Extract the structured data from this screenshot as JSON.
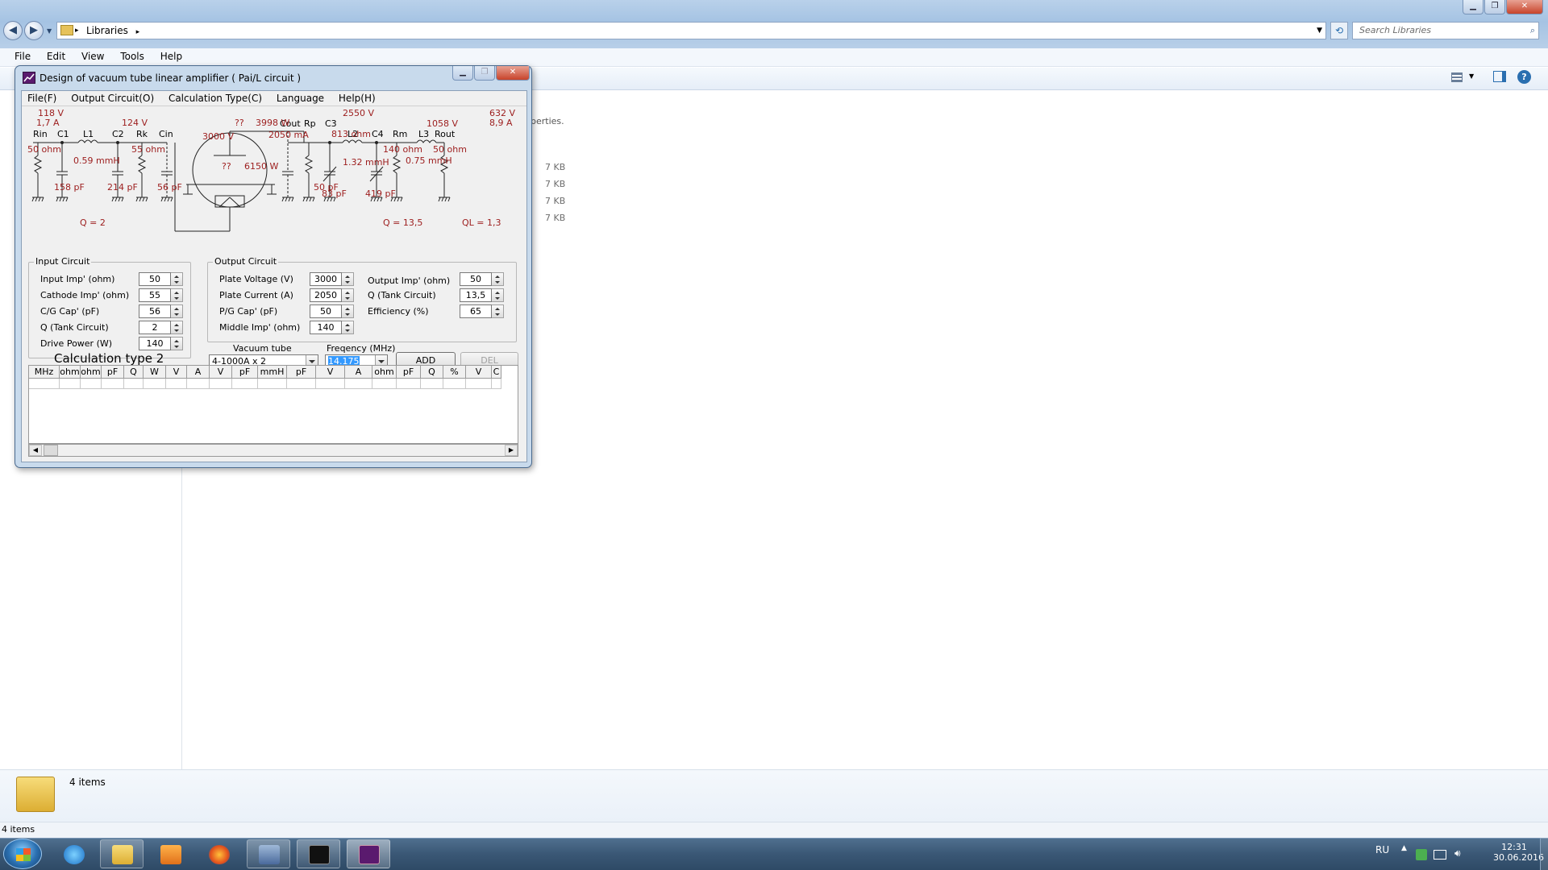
{
  "explorer": {
    "address_path": "Libraries",
    "search_placeholder": "Search Libraries",
    "menu": [
      "File",
      "Edit",
      "View",
      "Tools",
      "Help"
    ],
    "properties_fragment": "perties.",
    "file_sizes": [
      "7 KB",
      "7 KB",
      "7 KB",
      "7 KB"
    ],
    "details_count": "4 items",
    "status_count": "4 items"
  },
  "app": {
    "title": "Design of vacuum tube linear amplifier ( Pai/L circuit )",
    "menu": [
      "File(F)",
      "Output Circuit(O)",
      "Calculation Type(C)",
      "Language",
      "Help(H)"
    ],
    "schematic": {
      "drive_voltage": "118 V",
      "drive_current": "1,7 A",
      "cathode_voltage": "124 V",
      "plate_mark": "??",
      "plate_power": "3998 W",
      "plate_voltage_label": "3000 V",
      "plate_current_label": "2050 mA",
      "grid_mark": "??",
      "dissipation": "6150 W",
      "rp_voltage": "2550 V",
      "rp_value": "813 ohm",
      "mid_voltage": "1058 V",
      "out_voltage": "632 V",
      "out_current": "8,9 A",
      "labels": [
        "Rin",
        "C1",
        "L1",
        "C2",
        "Rk",
        "Cin",
        "Cout",
        "Rp",
        "C3",
        "L2",
        "C4",
        "Rm",
        "L3",
        "Rout"
      ],
      "rin_value": "50 ohm",
      "c1_value": "158 pF",
      "l1_value": "0.59 mmH",
      "c2_value": "214 pF",
      "rk_value": "55 ohm",
      "cin_value": "56 pF",
      "cout_value": "50 pF",
      "c3_value": "83 pF",
      "l2_value": "1.32 mmH",
      "c4_value": "419 pF",
      "rm_value": "140 ohm",
      "l3_value": "0.75 mmH",
      "rout_value": "50 ohm",
      "q_input": "Q = 2",
      "q_tank": "Q = 13,5",
      "q_loaded": "QL = 1,3"
    },
    "input_circuit": {
      "title": "Input Circuit",
      "fields": [
        {
          "label": "Input Imp' (ohm)",
          "value": "50"
        },
        {
          "label": "Cathode Imp' (ohm)",
          "value": "55"
        },
        {
          "label": "C/G Cap' (pF)",
          "value": "56"
        },
        {
          "label": "Q (Tank Circuit)",
          "value": "2"
        },
        {
          "label": "Drive Power (W)",
          "value": "140"
        }
      ]
    },
    "output_circuit": {
      "title": "Output Circuit",
      "left_fields": [
        {
          "label": "Plate Voltage (V)",
          "value": "3000"
        },
        {
          "label": "Plate Current (A)",
          "value": "2050"
        },
        {
          "label": "P/G Cap' (pF)",
          "value": "50"
        },
        {
          "label": "Middle Imp' (ohm)",
          "value": "140"
        }
      ],
      "right_fields": [
        {
          "label": "Output Imp' (ohm)",
          "value": "50"
        },
        {
          "label": "Q (Tank Circuit)",
          "value": "13,5"
        },
        {
          "label": "Efficiency (%)",
          "value": "65"
        }
      ]
    },
    "vacuum_tube": {
      "label": "Vacuum tube",
      "value": "4-1000A x 2"
    },
    "frequency": {
      "label": "Freqency (MHz)",
      "value": "14.175"
    },
    "add_label": "ADD",
    "del_label": "DEL",
    "calc_type": "Calculation type 2",
    "grid_headers": [
      "MHz",
      "ohm",
      "ohm",
      "pF",
      "Q",
      "W",
      "V",
      "A",
      "V",
      "pF",
      "mmH",
      "pF",
      "V",
      "A",
      "ohm",
      "pF",
      "Q",
      "%",
      "V",
      "C"
    ]
  },
  "taskbar": {
    "language": "RU",
    "time": "12:31",
    "date": "30.06.2016"
  },
  "colors": {
    "schematic_red": "#9c1c1c",
    "taskbar": "#3a5775",
    "title_blue": "#b9d1ea"
  }
}
